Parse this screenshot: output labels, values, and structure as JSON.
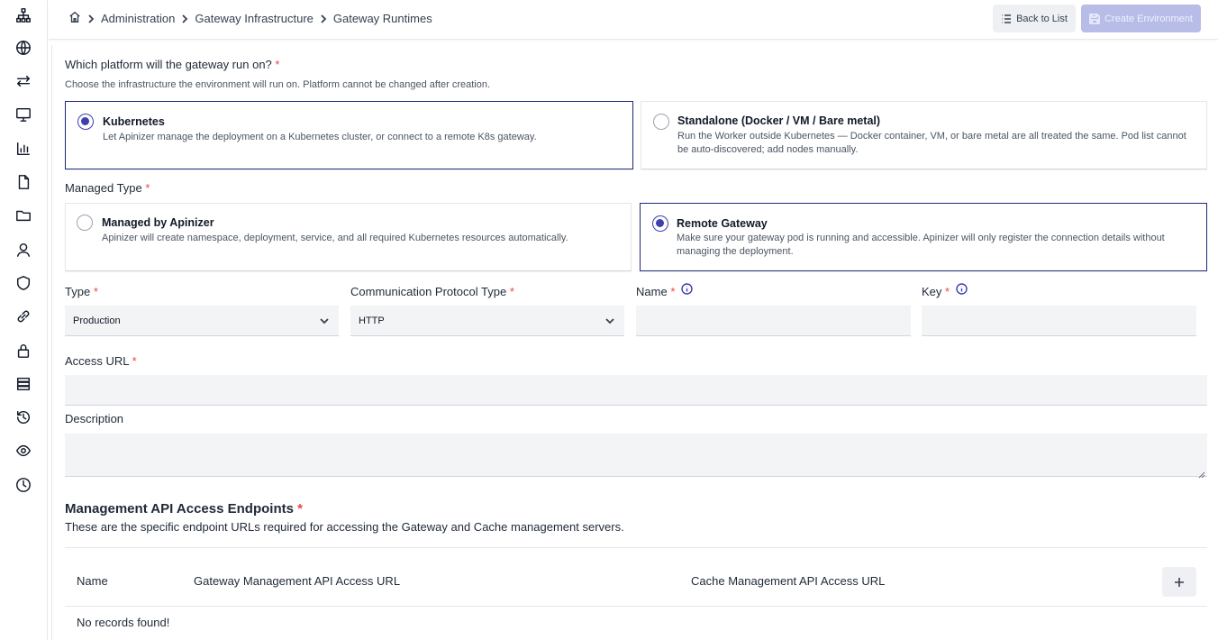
{
  "sidebar": {
    "items": [
      {
        "icon": "sitemap-icon"
      },
      {
        "icon": "globe-icon"
      },
      {
        "icon": "arrows-exchange-icon"
      },
      {
        "icon": "monitor-icon"
      },
      {
        "icon": "bar-chart-icon"
      },
      {
        "icon": "file-icon"
      },
      {
        "icon": "folder-icon"
      },
      {
        "icon": "user-icon"
      },
      {
        "icon": "shield-icon"
      },
      {
        "icon": "link-icon"
      },
      {
        "icon": "lock-icon"
      },
      {
        "icon": "server-list-icon"
      },
      {
        "icon": "history-icon"
      },
      {
        "icon": "eye-icon"
      },
      {
        "icon": "clock-icon"
      }
    ]
  },
  "breadcrumb": {
    "items": [
      "Administration",
      "Gateway Infrastructure",
      "Gateway Runtimes"
    ]
  },
  "toolbar": {
    "back_label": "Back to List",
    "create_label": "Create Environment"
  },
  "platform": {
    "question": "Which platform will the gateway run on?",
    "required_mark": "*",
    "hint": "Choose the infrastructure the environment will run on. Platform cannot be changed after creation.",
    "options": [
      {
        "title": "Kubernetes",
        "desc": "Let Apinizer manage the deployment on a Kubernetes cluster, or connect to a remote K8s gateway.",
        "selected": true
      },
      {
        "title": "Standalone (Docker / VM / Bare metal)",
        "desc": "Run the Worker outside Kubernetes — Docker container, VM, or bare metal are all treated the same. Pod list cannot be auto-discovered; add nodes manually.",
        "selected": false
      }
    ]
  },
  "managed": {
    "label": "Managed Type",
    "required_mark": "*",
    "options": [
      {
        "title": "Managed by Apinizer",
        "desc": "Apinizer will create namespace, deployment, service, and all required Kubernetes resources automatically.",
        "selected": false
      },
      {
        "title": "Remote Gateway",
        "desc": "Make sure your gateway pod is running and accessible. Apinizer will only register the connection details without managing the deployment.",
        "selected": true
      }
    ]
  },
  "fields": {
    "type_label": "Type",
    "type_value": "Production",
    "protocol_label": "Communication Protocol Type",
    "protocol_value": "HTTP",
    "name_label": "Name",
    "name_value": "",
    "key_label": "Key",
    "key_value": "",
    "access_url_label": "Access URL",
    "access_url_value": "",
    "description_label": "Description",
    "description_value": "",
    "required_mark": "*"
  },
  "endpoints": {
    "title": "Management API Access Endpoints",
    "required_mark": "*",
    "desc": "These are the specific endpoint URLs required for accessing the Gateway and Cache management servers.",
    "columns": [
      "Name",
      "Gateway Management API Access URL",
      "Cache Management API Access URL"
    ],
    "empty_text": "No records found!"
  },
  "colors": {
    "accent": "#3f3fb0",
    "selected_border": "#1e2a78",
    "required": "#ef4444",
    "create_button": "#b8bde8"
  }
}
